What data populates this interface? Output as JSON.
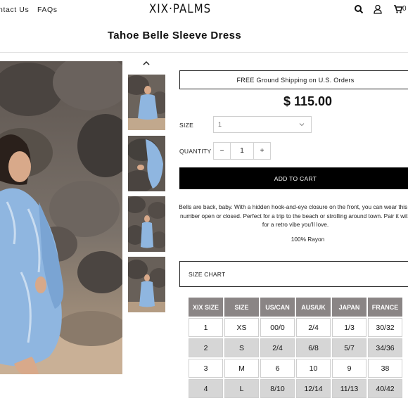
{
  "header": {
    "nav": [
      "ntact Us",
      "FAQs"
    ],
    "logo": "XIX·PALMS",
    "cart_count": "0"
  },
  "product": {
    "title": "Tahoe Belle Sleeve Dress",
    "shipping_notice": "FREE Ground Shipping on U.S. Orders",
    "price": "$ 115.00",
    "size_label": "SIZE",
    "size_value": "1",
    "quantity_label": "QUANTITY",
    "qty_minus": "−",
    "qty_value": "1",
    "qty_plus": "+",
    "add_to_cart": "ADD TO CART",
    "description_lines": [
      "Bells are back, baby. With a hidden hook-and-eye closure on the front, you can wear this fl",
      "number open or closed. Perfect for a trip to the beach or strolling around town. Pair it with",
      "for a retro vibe you'll love."
    ],
    "fabric": "100% Rayon",
    "size_chart_label": "SIZE CHART"
  },
  "size_table": {
    "headers": [
      "XIX SIZE",
      "SIZE",
      "US/CAN",
      "AUS/UK",
      "JAPAN",
      "FRANCE"
    ],
    "rows": [
      [
        "1",
        "XS",
        "00/0",
        "2/4",
        "1/3",
        "30/32"
      ],
      [
        "2",
        "S",
        "2/4",
        "6/8",
        "5/7",
        "34/36"
      ],
      [
        "3",
        "M",
        "6",
        "10",
        "9",
        "38"
      ],
      [
        "4",
        "L",
        "8/10",
        "12/14",
        "11/13",
        "40/42"
      ]
    ]
  },
  "colors": {
    "accent": "#000000",
    "table_header": "#8a8585",
    "row_shade": "#d6d6d6",
    "dress_blue": "#8fb6e0"
  },
  "icons": [
    "search-icon",
    "user-icon",
    "cart-icon",
    "chevron-up-icon",
    "chevron-down-icon"
  ]
}
